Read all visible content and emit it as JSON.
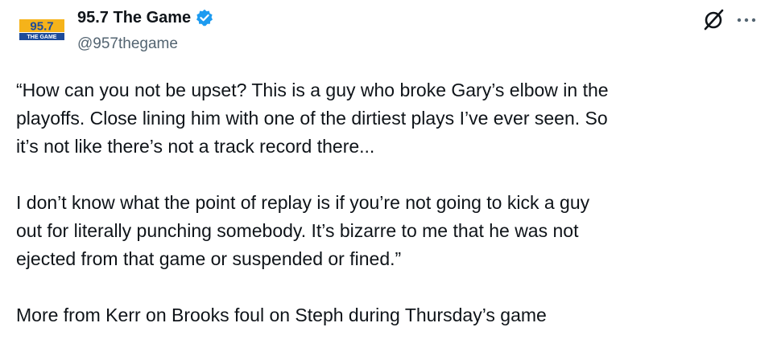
{
  "author": {
    "display_name": "95.7 The Game",
    "handle": "@957thegame",
    "verified": true,
    "avatar": {
      "logo_top": "95.7",
      "logo_bottom": "THE GAME",
      "colors": {
        "primary": "#f5b31a",
        "secondary": "#1d4b9a"
      }
    }
  },
  "actions": {
    "grok_icon": "grok-icon",
    "more_icon": "more-icon"
  },
  "tweet": {
    "paragraphs": [
      "“How can you not be upset? This is a guy who broke Gary’s elbow in the\nplayoffs. Close lining him with one of the dirtiest plays I’ve ever seen. So\nit’s not like there’s not a track record there...",
      "I don’t know what the point of replay is if you’re not going to kick a guy\nout for literally punching somebody. It’s bizarre to me that he was not\nejected from that game or suspended or fined.”",
      "More from Kerr on Brooks foul on Steph during Thursday’s game"
    ]
  },
  "colors": {
    "text": "#0f1419",
    "secondary_text": "#536471",
    "verified_badge": "#1d9bf0"
  }
}
